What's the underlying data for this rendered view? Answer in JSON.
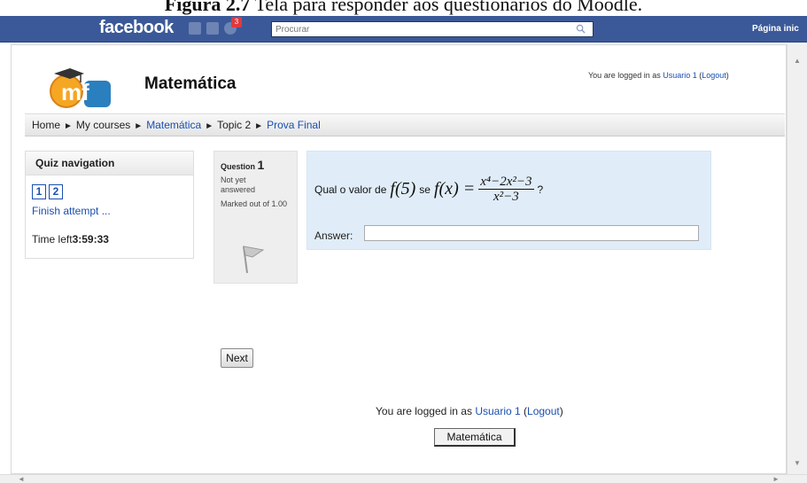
{
  "caption": {
    "prefix": "Figura 2.7",
    "text": " Tela para responder aos questionários do Moodle."
  },
  "facebook": {
    "logo": "facebook",
    "search_placeholder": "Procurar",
    "notification_count": "3",
    "home_link": "Página inic",
    "icons": [
      "friends-icon",
      "messages-icon",
      "notifications-globe-icon",
      "search-icon"
    ]
  },
  "site": {
    "title": "Matemática",
    "logo_text": "mf",
    "login_prefix": "You are logged in as ",
    "user": "Usuario 1",
    "logout_open": " (",
    "logout": "Logout",
    "logout_close": ")"
  },
  "breadcrumb": {
    "items": [
      "Home",
      "My courses",
      "Matemática",
      "Topic 2",
      "Prova Final"
    ],
    "separator": "►"
  },
  "quiz_navigation": {
    "title": "Quiz navigation",
    "questions": [
      "1",
      "2"
    ],
    "finish": "Finish attempt ...",
    "time_label": "Time left",
    "time_value": "3:59:33"
  },
  "question": {
    "label": "Question ",
    "number": "1",
    "state": "Not yet answered",
    "marks": "Marked out of 1.00",
    "text_prefix": "Qual o valor de",
    "f5": "f(5)",
    "se": "se",
    "fx": "f(x) =",
    "numerator": "x⁴−2x²−3",
    "denominator": "x²−3",
    "text_suffix": "?",
    "answer_label": "Answer:",
    "answer_value": ""
  },
  "buttons": {
    "next": "Next"
  },
  "footer": {
    "login_prefix": "You are logged in as ",
    "user": "Usuario 1",
    "logout_open": " (",
    "logout": "Logout",
    "logout_close": ")",
    "course_button": "Matemática"
  },
  "colors": {
    "facebook_blue": "#3b5998",
    "link": "#1a4fb0",
    "question_bg": "#e0edf8",
    "info_bg": "#eeeeee"
  }
}
